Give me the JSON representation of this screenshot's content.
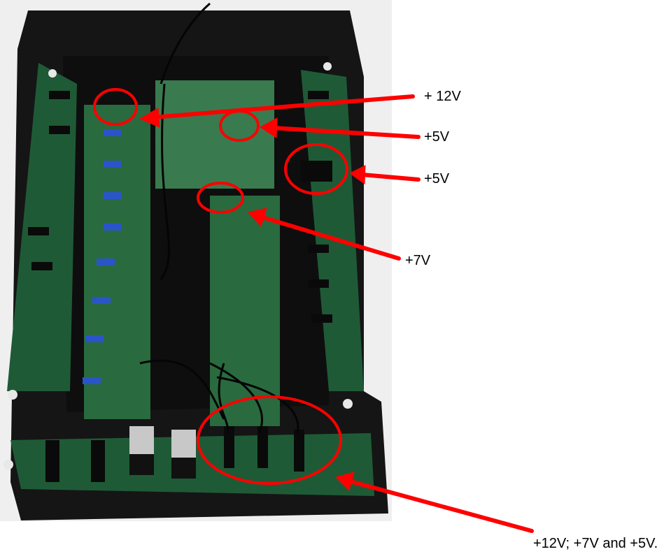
{
  "labels": {
    "plus_12v": "+ 12V",
    "plus_5v_a": "+5V",
    "plus_5v_b": "+5V",
    "plus_7v": "+7V",
    "combined": "+12V; +7V and +5V."
  },
  "colors": {
    "annotation": "#ff0000",
    "enclosure": "#151515",
    "pcb_green": "#1f5a36",
    "pcb_light": "#3a7a4f",
    "jumper_blue": "#2a55c8"
  }
}
